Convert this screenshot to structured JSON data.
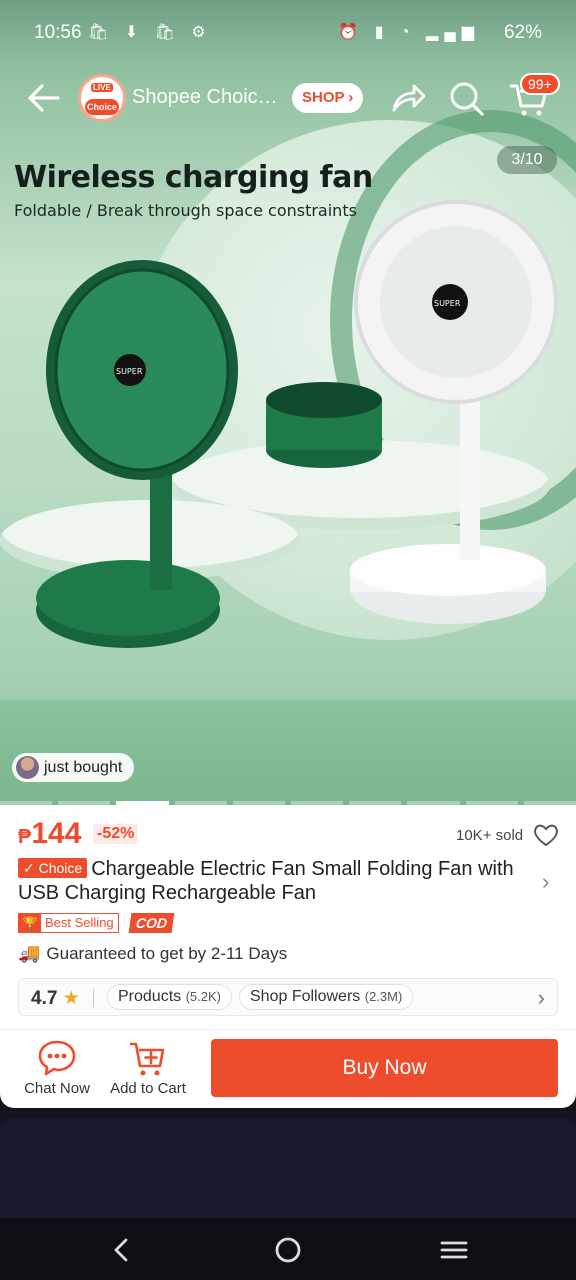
{
  "status_bar": {
    "time": "10:56",
    "battery": "62%"
  },
  "nav": {
    "shop_name": "Shopee Choice Official Store",
    "shop_button": "SHOP",
    "logo_live": "LIVE",
    "logo_choice": "Choice",
    "cart_count": "99+"
  },
  "hero": {
    "counter": "3/10",
    "title": "Wireless charging fan",
    "subtitle": "Foldable / Break through space constraints",
    "fan_label": "SUPER",
    "just_bought": "just bought",
    "slides_total": 10,
    "slides_active_index": 2
  },
  "product": {
    "currency": "₱",
    "price": "144",
    "discount": "-52%",
    "sold": "10K+ sold",
    "choice_tag": "Choice",
    "title": "Chargeable Electric Fan Small Folding Fan with USB Charging Rechargeable Fan",
    "best_selling": "Best Selling",
    "cod": "COD",
    "guarantee": "Guaranteed to get by 2-11 Days"
  },
  "shop_stats": {
    "rating": "4.7",
    "products_label": "Products",
    "products_count": "(5.2K)",
    "followers_label": "Shop Followers",
    "followers_count": "(2.3M)"
  },
  "actions": {
    "chat": "Chat Now",
    "add_to_cart": "Add to Cart",
    "buy_now": "Buy Now"
  },
  "colors": {
    "accent": "#ee4d2d",
    "rating_star": "#f5a623",
    "truck": "#1aa38a",
    "fan_green": "#1f7a4a"
  }
}
